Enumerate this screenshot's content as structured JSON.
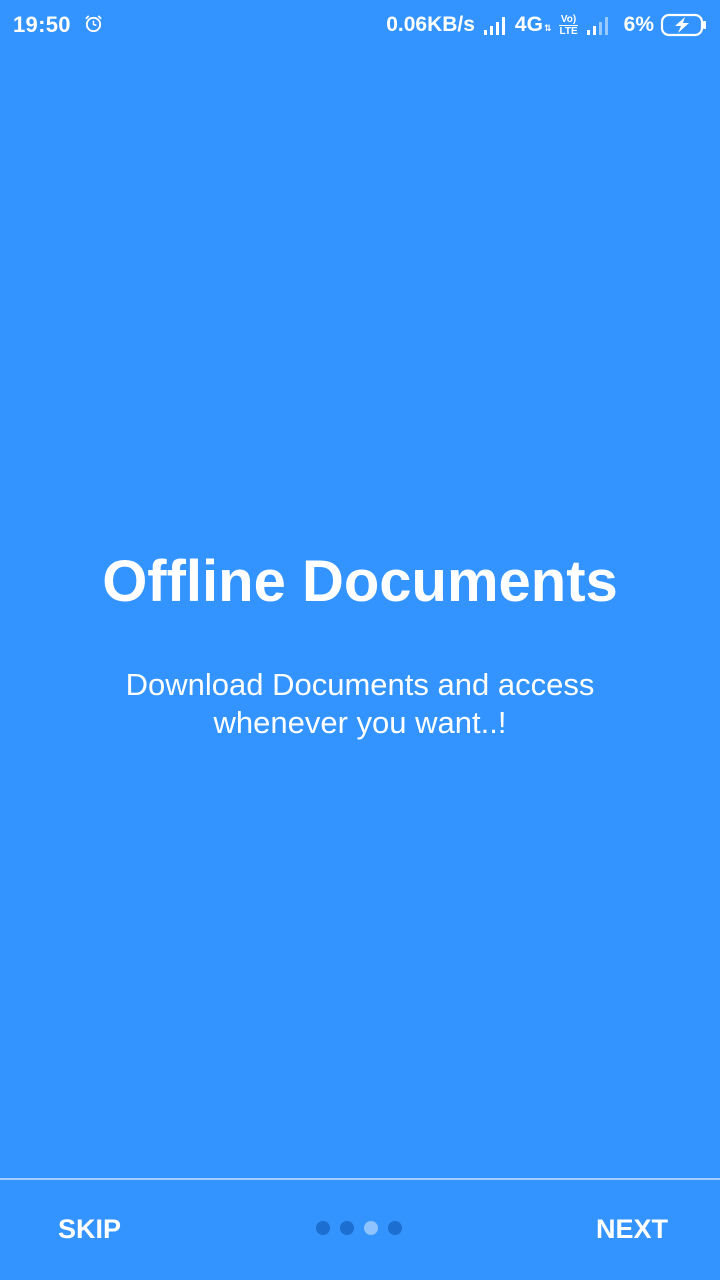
{
  "status_bar": {
    "time": "19:50",
    "net_speed": "0.06KB/s",
    "net_type": "4G",
    "net_arrows": "⇅",
    "volte_line1": "Vo)",
    "volte_line2": "LTE",
    "battery_percent": "6%",
    "icons": [
      "alarm-icon",
      "signal-icon",
      "volte-icon",
      "battery-charging-icon"
    ]
  },
  "onboarding": {
    "title": "Offline Documents",
    "description": "Download Documents and access whenever you want..!",
    "page_count": 4,
    "active_page": 3
  },
  "navigation": {
    "skip_label": "SKIP",
    "next_label": "NEXT"
  },
  "colors": {
    "background": "#3394ff",
    "dot_inactive": "#1c6ed0",
    "dot_active": "#8fc3ff",
    "text": "#ffffff"
  }
}
